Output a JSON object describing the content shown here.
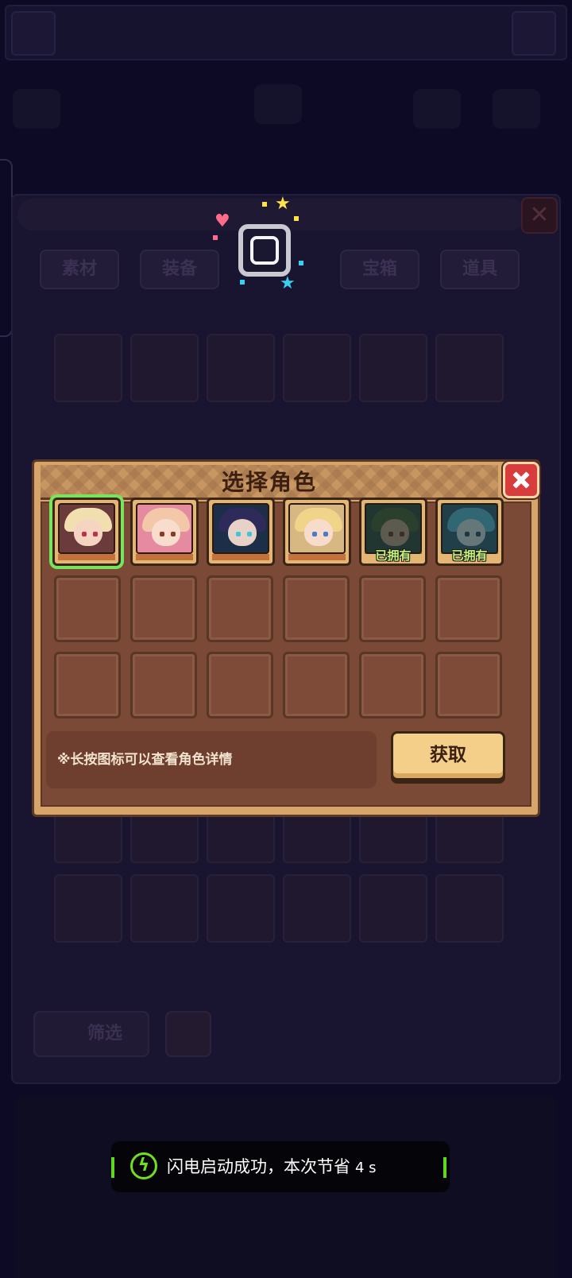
{
  "background": {
    "tabs": [
      "素材",
      "装备",
      "宝箱",
      "道具"
    ],
    "filter_label": "筛选"
  },
  "dialog": {
    "title": "选择角色",
    "hint": "※长按图标可以查看角色详情",
    "get_button": "获取",
    "characters": [
      {
        "name": "character-1",
        "selected": true,
        "owned": false,
        "status": ""
      },
      {
        "name": "character-2",
        "selected": false,
        "owned": false,
        "status": ""
      },
      {
        "name": "character-3",
        "selected": false,
        "owned": false,
        "status": ""
      },
      {
        "name": "character-4",
        "selected": false,
        "owned": false,
        "status": ""
      },
      {
        "name": "character-5",
        "selected": false,
        "owned": true,
        "status": "已拥有"
      },
      {
        "name": "character-6",
        "selected": false,
        "owned": true,
        "status": "已拥有"
      }
    ]
  },
  "toast": {
    "message": "闪电启动成功，本次节省",
    "seconds": "4 s"
  },
  "colors": {
    "accent_green": "#76e45c",
    "close_red": "#d83d3d",
    "button_gold": "#f3cf8a",
    "owned_text": "#c5f37a"
  }
}
